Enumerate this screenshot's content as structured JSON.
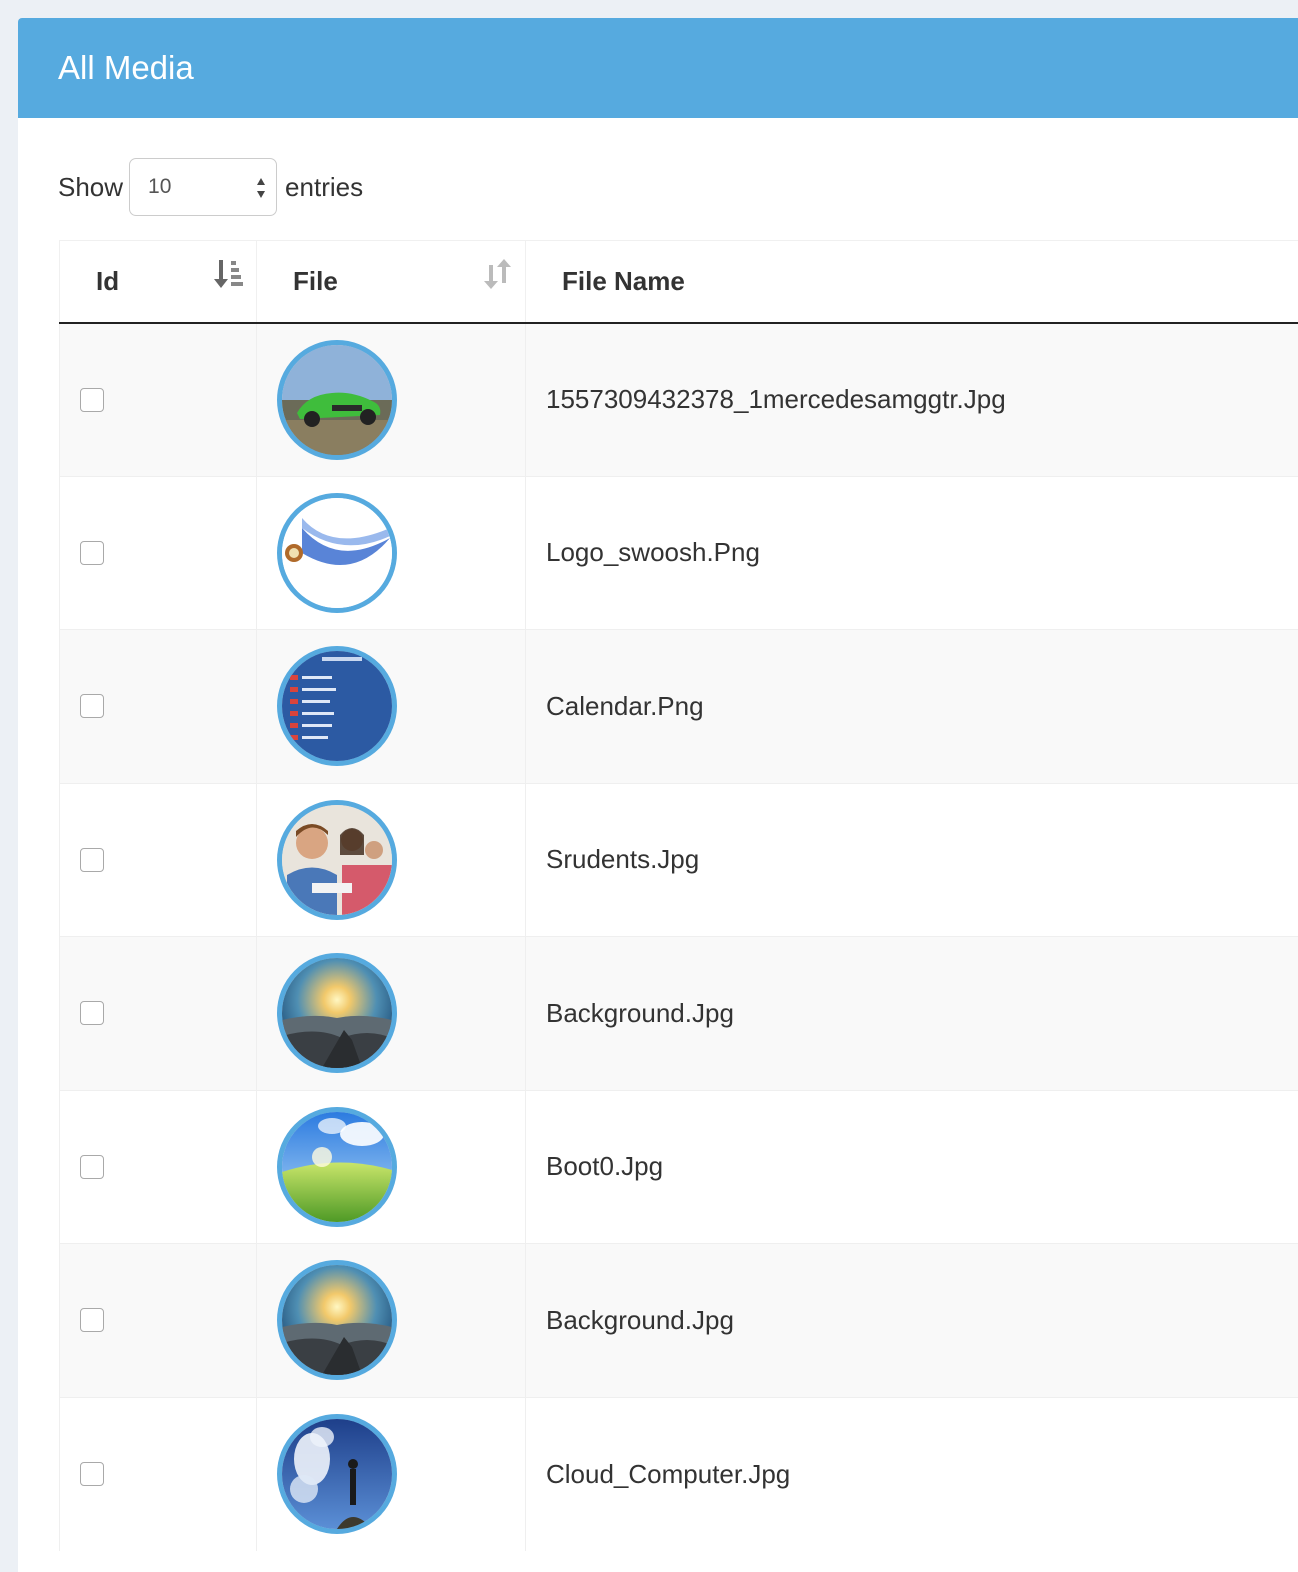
{
  "panel": {
    "title": "All Media"
  },
  "length_menu": {
    "show_label": "Show",
    "selected": "10",
    "entries_label": "entries"
  },
  "table": {
    "columns": [
      "Id",
      "File",
      "File Name"
    ],
    "rows": [
      {
        "file_name": "1557309432378_1mercedesamggtr.Jpg",
        "thumb": "green-car-image"
      },
      {
        "file_name": "Logo_swoosh.Png",
        "thumb": "blue-swoosh-logo-image"
      },
      {
        "file_name": "Calendar.Png",
        "thumb": "calendar-image"
      },
      {
        "file_name": "Srudents.Jpg",
        "thumb": "students-image"
      },
      {
        "file_name": "Background.Jpg",
        "thumb": "mountain-sunrise-image"
      },
      {
        "file_name": "Boot0.Jpg",
        "thumb": "green-hill-sky-image"
      },
      {
        "file_name": "Background.Jpg",
        "thumb": "mountain-sunrise-image"
      },
      {
        "file_name": "Cloud_Computer.Jpg",
        "thumb": "cloud-person-image"
      }
    ]
  },
  "colors": {
    "header": "#56aadf",
    "thumb_border": "#56aadf",
    "page_bg": "#ecf0f5"
  }
}
